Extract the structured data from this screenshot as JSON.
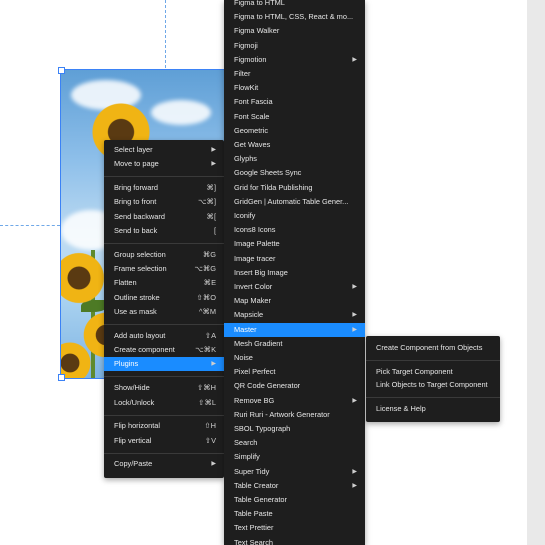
{
  "context_menu": {
    "items": [
      {
        "label": "Select layer",
        "shortcut": "",
        "arrow": true
      },
      {
        "label": "Move to page",
        "shortcut": "",
        "arrow": true
      },
      {
        "sep": true
      },
      {
        "label": "Bring forward",
        "shortcut": "⌘]"
      },
      {
        "label": "Bring to front",
        "shortcut": "⌥⌘]"
      },
      {
        "label": "Send backward",
        "shortcut": "⌘["
      },
      {
        "label": "Send to back",
        "shortcut": "["
      },
      {
        "sep": true
      },
      {
        "label": "Group selection",
        "shortcut": "⌘G"
      },
      {
        "label": "Frame selection",
        "shortcut": "⌥⌘G"
      },
      {
        "label": "Flatten",
        "shortcut": "⌘E"
      },
      {
        "label": "Outline stroke",
        "shortcut": "⇧⌘O"
      },
      {
        "label": "Use as mask",
        "shortcut": "^⌘M"
      },
      {
        "sep": true
      },
      {
        "label": "Add auto layout",
        "shortcut": "⇧A"
      },
      {
        "label": "Create component",
        "shortcut": "⌥⌘K"
      },
      {
        "label": "Plugins",
        "shortcut": "",
        "arrow": true,
        "highlighted": true
      },
      {
        "sep": true
      },
      {
        "label": "Show/Hide",
        "shortcut": "⇧⌘H"
      },
      {
        "label": "Lock/Unlock",
        "shortcut": "⇧⌘L"
      },
      {
        "sep": true
      },
      {
        "label": "Flip horizontal",
        "shortcut": "⇧H"
      },
      {
        "label": "Flip vertical",
        "shortcut": "⇧V"
      },
      {
        "sep": true
      },
      {
        "label": "Copy/Paste",
        "shortcut": "",
        "arrow": true
      }
    ]
  },
  "plugins_menu": {
    "items": [
      {
        "label": "Figma to HTML"
      },
      {
        "label": "Figma to HTML, CSS, React & mo..."
      },
      {
        "label": "Figma Walker"
      },
      {
        "label": "Figmoji"
      },
      {
        "label": "Figmotion",
        "arrow": true
      },
      {
        "label": "Filter"
      },
      {
        "label": "FlowKit"
      },
      {
        "label": "Font Fascia"
      },
      {
        "label": "Font Scale"
      },
      {
        "label": "Geometric"
      },
      {
        "label": "Get Waves"
      },
      {
        "label": "Glyphs"
      },
      {
        "label": "Google Sheets Sync"
      },
      {
        "label": "Grid for Tilda Publishing"
      },
      {
        "label": "GridGen | Automatic Table Gener..."
      },
      {
        "label": "Iconify"
      },
      {
        "label": "Icons8 Icons"
      },
      {
        "label": "Image Palette"
      },
      {
        "label": "Image tracer"
      },
      {
        "label": "Insert Big Image"
      },
      {
        "label": "Invert Color",
        "arrow": true
      },
      {
        "label": "Map Maker"
      },
      {
        "label": "Mapsicle",
        "arrow": true
      },
      {
        "label": "Master",
        "arrow": true,
        "highlighted": true
      },
      {
        "label": "Mesh Gradient"
      },
      {
        "label": "Noise"
      },
      {
        "label": "Pixel Perfect"
      },
      {
        "label": "QR Code Generator"
      },
      {
        "label": "Remove BG",
        "arrow": true
      },
      {
        "label": "Ruri Ruri - Artwork Generator"
      },
      {
        "label": "SBOL Typograph"
      },
      {
        "label": "Search"
      },
      {
        "label": "Simplify"
      },
      {
        "label": "Super Tidy",
        "arrow": true
      },
      {
        "label": "Table Creator",
        "arrow": true
      },
      {
        "label": "Table Generator"
      },
      {
        "label": "Table Paste"
      },
      {
        "label": "Text Prettier"
      },
      {
        "label": "Text Search"
      }
    ]
  },
  "master_submenu": {
    "items": [
      {
        "label": "Create Component from Objects"
      },
      {
        "sep": true
      },
      {
        "label": "Pick Target Component"
      },
      {
        "label": "Link Objects to Target Component"
      },
      {
        "sep": true
      },
      {
        "label": "License & Help"
      }
    ]
  },
  "colors": {
    "menu_bg": "#1e1e1e",
    "highlight": "#1a8cff",
    "selection": "#3b82f6"
  }
}
